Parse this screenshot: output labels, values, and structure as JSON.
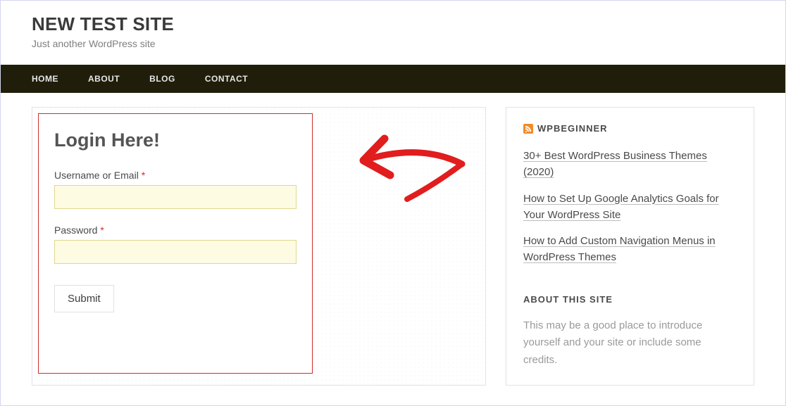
{
  "header": {
    "title": "NEW TEST SITE",
    "tagline": "Just another WordPress site"
  },
  "nav": {
    "items": [
      "HOME",
      "ABOUT",
      "BLOG",
      "CONTACT"
    ]
  },
  "login": {
    "title": "Login Here!",
    "username_label": "Username or Email",
    "password_label": "Password",
    "required_mark": "*",
    "submit_label": "Submit"
  },
  "sidebar": {
    "feed_title": "WPBEGINNER",
    "feed_items": [
      "30+ Best WordPress Business Themes (2020)",
      "How to Set Up Google Analytics Goals for Your WordPress Site",
      "How to Add Custom Navigation Menus in WordPress Themes"
    ],
    "about_title": "ABOUT THIS SITE",
    "about_text": "This may be a good place to introduce yourself and your site or include some credits."
  },
  "annotation": {
    "arrow_color": "#e11d1d"
  }
}
